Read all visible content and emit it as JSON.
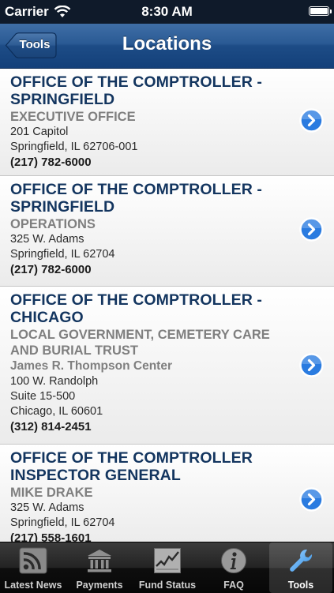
{
  "status_bar": {
    "carrier": "Carrier",
    "time": "8:30 AM"
  },
  "nav": {
    "title": "Locations",
    "back_label": "Tools"
  },
  "locations": [
    {
      "name_lines": [
        "OFFICE OF THE COMPTROLLER -",
        "SPRINGFIELD"
      ],
      "department": "EXECUTIVE OFFICE",
      "address_lines": [
        "201 Capitol",
        "Springfield, IL 62706-001"
      ],
      "phone": "(217) 782-6000"
    },
    {
      "name_lines": [
        "OFFICE OF THE COMPTROLLER -",
        "SPRINGFIELD"
      ],
      "department": "OPERATIONS",
      "address_lines": [
        "325 W. Adams",
        "Springfield, IL 62704"
      ],
      "phone": "(217) 782-6000"
    },
    {
      "name_lines": [
        "OFFICE OF THE COMPTROLLER -",
        "CHICAGO"
      ],
      "department": "LOCAL GOVERNMENT, CEMETERY CARE AND BURIAL TRUST",
      "building": "James R. Thompson Center",
      "address_lines": [
        "100 W. Randolph",
        "Suite 15-500",
        "Chicago, IL 60601"
      ],
      "phone": "(312) 814-2451"
    },
    {
      "name_lines": [
        "OFFICE OF THE COMPTROLLER",
        "INSPECTOR GENERAL"
      ],
      "department": "MIKE DRAKE",
      "address_lines": [
        "325 W. Adams",
        "Springfield, IL 62704"
      ],
      "phone": "(217) 558-1601"
    }
  ],
  "tabs": [
    {
      "label": "Latest News",
      "icon": "rss-icon",
      "selected": false
    },
    {
      "label": "Payments",
      "icon": "bank-icon",
      "selected": false
    },
    {
      "label": "Fund Status",
      "icon": "chart-icon",
      "selected": false
    },
    {
      "label": "FAQ",
      "icon": "info-icon",
      "selected": false
    },
    {
      "label": "Tools",
      "icon": "wrench-icon",
      "selected": true
    }
  ],
  "colors": {
    "nav_bar": "#1d4c86",
    "location_name": "#13355f",
    "disclosure_button": "#2a7be0"
  }
}
